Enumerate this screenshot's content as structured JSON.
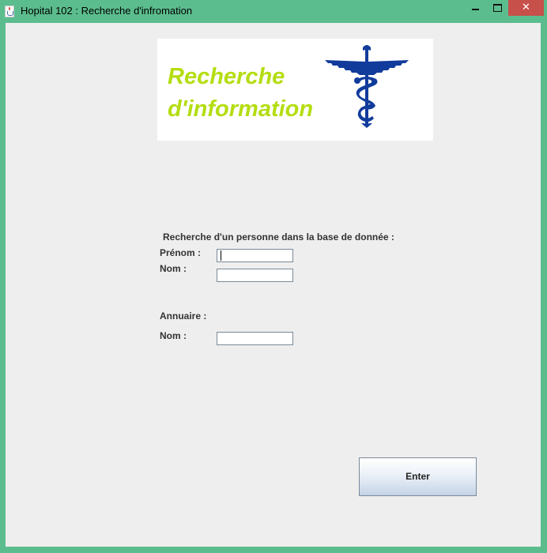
{
  "window": {
    "title": "Hopital 102 : Recherche d'infromation",
    "close_symbol": "✕",
    "colors": {
      "frame": "#5bbd8d",
      "close_button": "#c7504b",
      "client_background": "#eeeeee"
    }
  },
  "banner": {
    "line1": "Recherche",
    "line2": "d'information",
    "icon": "caduceus-icon",
    "text_color": "#b4dd10",
    "icon_color": "#123c9c"
  },
  "search_section": {
    "heading": "Recherche d'un personne dans la base de donnée :",
    "prenom_label": "Prénom :",
    "prenom_value": "",
    "nom_label": "Nom :",
    "nom_value": ""
  },
  "annuaire_section": {
    "heading": "Annuaire :",
    "nom_label": "Nom :",
    "nom_value": ""
  },
  "enter_button": {
    "label": "Enter"
  }
}
